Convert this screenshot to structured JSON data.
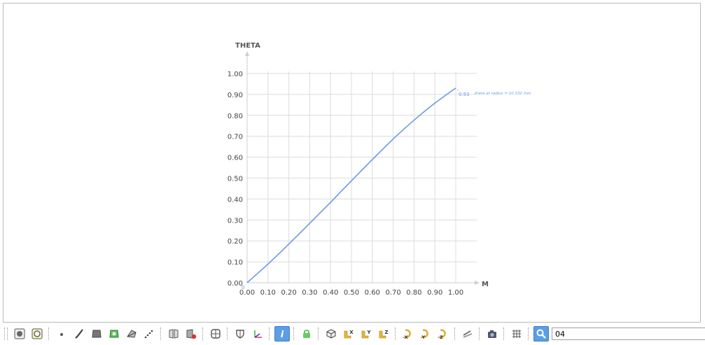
{
  "chart_data": {
    "type": "line",
    "title": "",
    "xlabel": "M",
    "ylabel": "THETA",
    "xlim": [
      0,
      1.0
    ],
    "ylim": [
      0,
      1.0
    ],
    "x_ticks": [
      "0.00",
      "0.10",
      "0.20",
      "0.30",
      "0.40",
      "0.50",
      "0.60",
      "0.70",
      "0.80",
      "0.90",
      "1.00"
    ],
    "y_ticks": [
      "0.00",
      "0.10",
      "0.20",
      "0.30",
      "0.40",
      "0.50",
      "0.60",
      "0.70",
      "0.80",
      "0.90",
      "1.00"
    ],
    "grid": true,
    "series": [
      {
        "name": "theta at radius = 10.332 mm",
        "color": "#6a9be3",
        "x": [
          0,
          0.05,
          0.1,
          0.15,
          0.2,
          0.25,
          0.3,
          0.35,
          0.4,
          0.45,
          0.5,
          0.55,
          0.6,
          0.65,
          0.7,
          0.75,
          0.8,
          0.85,
          0.9,
          0.95,
          1.0
        ],
        "y": [
          0,
          0.044,
          0.089,
          0.136,
          0.185,
          0.234,
          0.284,
          0.334,
          0.384,
          0.436,
          0.487,
          0.538,
          0.589,
          0.638,
          0.687,
          0.733,
          0.777,
          0.819,
          0.859,
          0.895,
          0.93
        ]
      }
    ],
    "annotations": {
      "start_label": "0",
      "end_value_label": "0.93",
      "series_label": "theta at radius = 10.332 mm"
    }
  },
  "toolbar": {
    "search_value": "04",
    "buttons": [
      {
        "icon": "filled-circle-frame-icon"
      },
      {
        "icon": "ring-frame-icon"
      },
      {
        "sep": true
      },
      {
        "icon": "point-icon"
      },
      {
        "icon": "curve-icon"
      },
      {
        "icon": "surface-icon"
      },
      {
        "icon": "green-face-icon"
      },
      {
        "icon": "solid-icon"
      },
      {
        "icon": "points-line-icon"
      },
      {
        "sep": true
      },
      {
        "icon": "split-faces-icon"
      },
      {
        "icon": "delete-faces-icon"
      },
      {
        "sep": true
      },
      {
        "icon": "grid-quad-icon"
      },
      {
        "sep": true
      },
      {
        "icon": "shield-icon"
      },
      {
        "icon": "axes-icon"
      },
      {
        "sep": true
      },
      {
        "icon": "info-icon",
        "active": true
      },
      {
        "sep": true
      },
      {
        "icon": "lock-icon"
      },
      {
        "sep": true
      },
      {
        "icon": "cube-view-icon"
      },
      {
        "icon": "view-x-icon",
        "letter": "X"
      },
      {
        "icon": "view-y-icon",
        "letter": "Y"
      },
      {
        "icon": "view-z-icon",
        "letter": "Z"
      },
      {
        "sep": true
      },
      {
        "icon": "rotate-neg-x-icon",
        "letter": "-X"
      },
      {
        "icon": "rotate-neg-y-icon",
        "letter": "-Y"
      },
      {
        "icon": "rotate-neg-z-icon",
        "letter": "-Z"
      },
      {
        "sep": true
      },
      {
        "icon": "section-icon"
      },
      {
        "sep": true
      },
      {
        "icon": "camera-icon"
      },
      {
        "sep": true
      },
      {
        "icon": "grid-icon"
      },
      {
        "sep": true
      },
      {
        "icon": "search-icon",
        "active": true
      }
    ]
  }
}
